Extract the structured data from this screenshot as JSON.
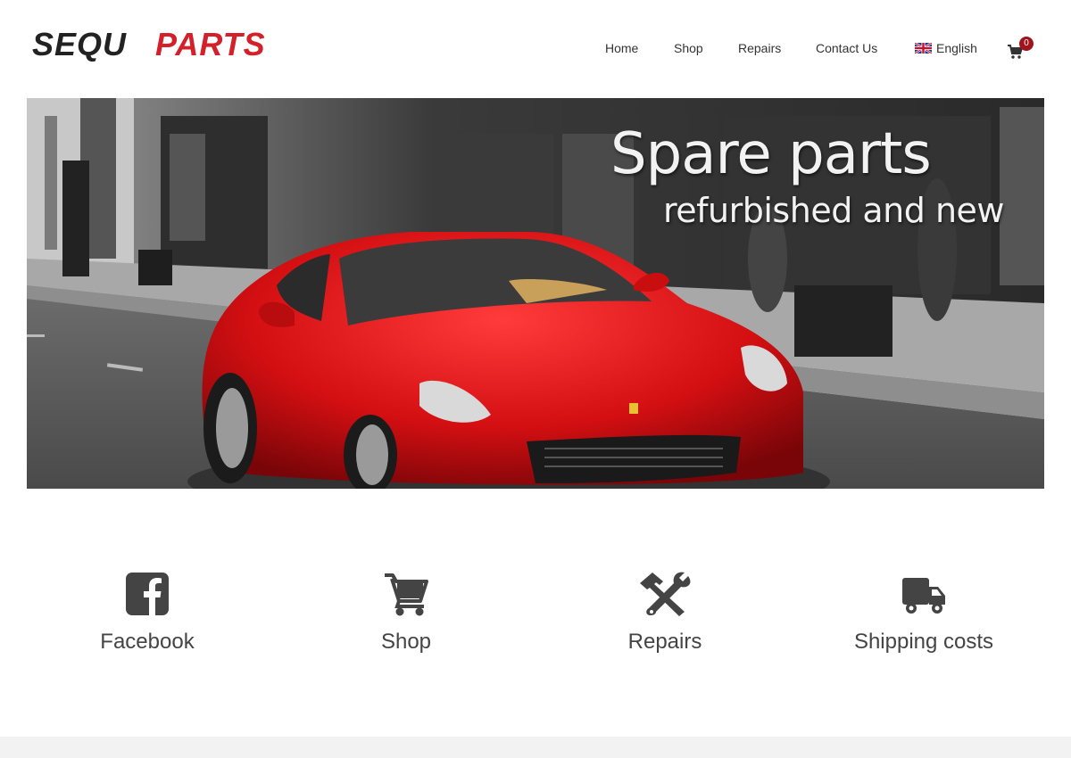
{
  "brand": {
    "logo_text": "SEQUPARTS"
  },
  "nav": {
    "items": [
      {
        "label": "Home"
      },
      {
        "label": "Shop"
      },
      {
        "label": "Repairs"
      },
      {
        "label": "Contact Us"
      }
    ],
    "language": "English",
    "cart_count": "0"
  },
  "hero": {
    "title": "Spare parts",
    "subtitle": "refurbished and new"
  },
  "features": [
    {
      "label": "Facebook",
      "icon": "facebook-icon"
    },
    {
      "label": "Shop",
      "icon": "cart-icon"
    },
    {
      "label": "Repairs",
      "icon": "tools-icon"
    },
    {
      "label": "Shipping costs",
      "icon": "truck-icon"
    }
  ],
  "colors": {
    "accent": "#d4202a",
    "badge": "#a0141c",
    "icon": "#444444"
  }
}
